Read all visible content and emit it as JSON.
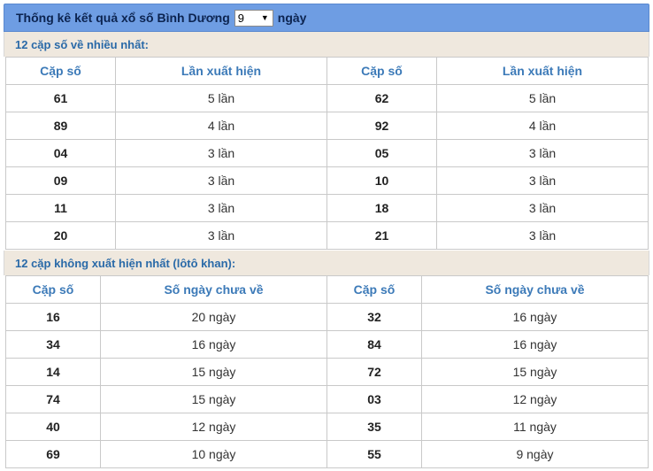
{
  "header": {
    "title_prefix": "Thống kê kết quả xổ số Bình Dương",
    "days_select_value": "9",
    "title_suffix": "ngày"
  },
  "section1": {
    "title": "12 cặp số về nhiều nhất:",
    "headers": [
      "Cặp số",
      "Lần xuất hiện",
      "Cặp số",
      "Lần xuất hiện"
    ],
    "rows": [
      [
        "61",
        "5 lần",
        "62",
        "5 lần"
      ],
      [
        "89",
        "4 lần",
        "92",
        "4 lần"
      ],
      [
        "04",
        "3 lần",
        "05",
        "3 lần"
      ],
      [
        "09",
        "3 lần",
        "10",
        "3 lần"
      ],
      [
        "11",
        "3 lần",
        "18",
        "3 lần"
      ],
      [
        "20",
        "3 lần",
        "21",
        "3 lần"
      ]
    ]
  },
  "section2": {
    "title": "12 cặp không xuất hiện nhất (lôtô khan):",
    "headers": [
      "Cặp số",
      "Số ngày chưa về",
      "Cặp số",
      "Số ngày chưa về"
    ],
    "rows": [
      [
        "16",
        "20 ngày",
        "32",
        "16 ngày"
      ],
      [
        "34",
        "16 ngày",
        "84",
        "16 ngày"
      ],
      [
        "14",
        "15 ngày",
        "72",
        "15 ngày"
      ],
      [
        "74",
        "15 ngày",
        "03",
        "12 ngày"
      ],
      [
        "40",
        "12 ngày",
        "35",
        "11 ngày"
      ],
      [
        "69",
        "10 ngày",
        "55",
        "9 ngày"
      ]
    ]
  }
}
